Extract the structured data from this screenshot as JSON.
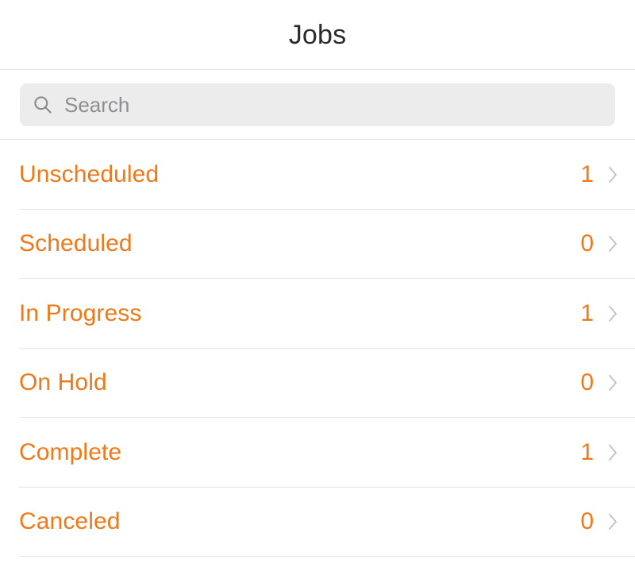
{
  "header": {
    "title": "Jobs"
  },
  "search": {
    "icon": "search-icon",
    "placeholder": "Search",
    "value": ""
  },
  "colors": {
    "accent_orange": "#f07818",
    "title_text": "#2b2b2b",
    "divider": "#e3e3e3",
    "search_background": "#ececec",
    "placeholder_text": "#8e8e93",
    "chevron": "#c4c4c6",
    "page_background": "#ffffff"
  },
  "list": {
    "rows": [
      {
        "label": "Unscheduled",
        "count": "1",
        "chevron": "chevron-right-icon"
      },
      {
        "label": "Scheduled",
        "count": "0",
        "chevron": "chevron-right-icon"
      },
      {
        "label": "In Progress",
        "count": "1",
        "chevron": "chevron-right-icon"
      },
      {
        "label": "On Hold",
        "count": "0",
        "chevron": "chevron-right-icon"
      },
      {
        "label": "Complete",
        "count": "1",
        "chevron": "chevron-right-icon"
      },
      {
        "label": "Canceled",
        "count": "0",
        "chevron": "chevron-right-icon"
      }
    ]
  }
}
